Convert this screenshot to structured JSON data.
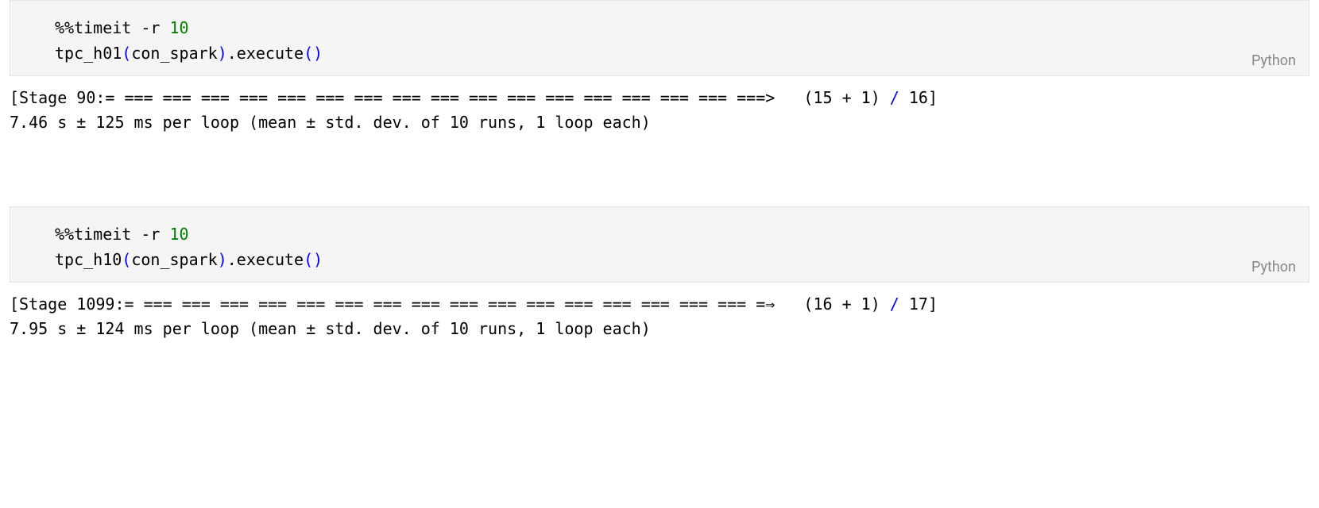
{
  "cells": [
    {
      "lang": "Python",
      "code": {
        "line1_magic": "%%timeit -r ",
        "line1_num": "10",
        "line2_fn": "tpc_h01",
        "line2_arg": "con_spark",
        "line2_tail_method": ".execute",
        "line2_paren_open": "(",
        "line2_paren_close": ")"
      },
      "output": {
        "stage_prefix": "[Stage 90:",
        "progress": "= === === === === === === === === === === === === === === === === ===>",
        "after_progress": "   (15 + 1) ",
        "slash": "/",
        "after_slash": " 16]",
        "timing": "7.46 s ± 125 ms per loop (mean ± std. dev. of 10 runs, 1 loop each)"
      }
    },
    {
      "lang": "Python",
      "code": {
        "line1_magic": "%%timeit -r ",
        "line1_num": "10",
        "line2_fn": "tpc_h10",
        "line2_arg": "con_spark",
        "line2_tail_method": ".execute",
        "line2_paren_open": "(",
        "line2_paren_close": ")"
      },
      "output": {
        "stage_prefix": "[Stage 1099:",
        "progress": "= === === === === === === === === === === === === === === === === =⇒",
        "after_progress": "   (16 + 1) ",
        "slash": "/",
        "after_slash": " 17]",
        "timing": "7.95 s ± 124 ms per loop (mean ± std. dev. of 10 runs, 1 loop each)"
      }
    }
  ]
}
